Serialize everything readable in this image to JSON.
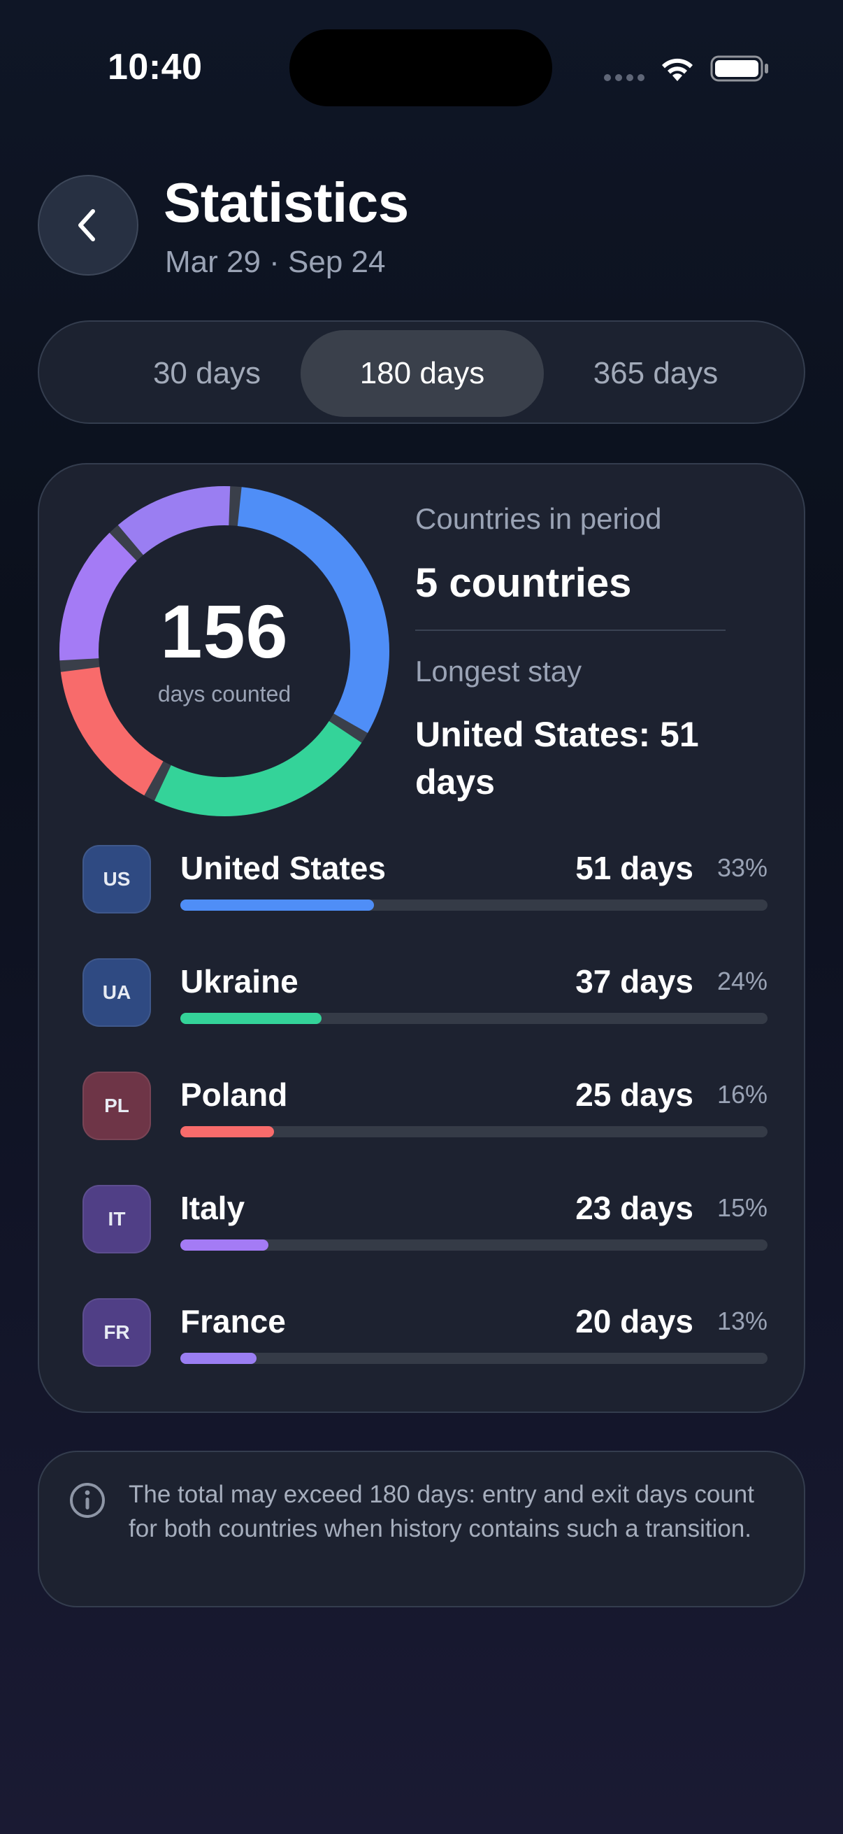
{
  "status_bar": {
    "time": "10:40"
  },
  "header": {
    "title": "Statistics",
    "subtitle": "Mar 29 · Sep 24"
  },
  "period_tabs": [
    {
      "label": "30 days",
      "selected": false
    },
    {
      "label": "180 days",
      "selected": true
    },
    {
      "label": "365 days",
      "selected": false
    }
  ],
  "summary": {
    "total_days": "156",
    "total_label": "days counted",
    "countries_label": "Countries in period",
    "countries_value": "5 countries",
    "longest_label": "Longest stay",
    "longest_value": "United States: 51 days"
  },
  "chart_data": {
    "type": "pie",
    "categories": [
      "United States",
      "Ukraine",
      "Poland",
      "Italy",
      "France"
    ],
    "values": [
      51,
      37,
      25,
      23,
      20
    ],
    "colors": [
      "#4f8ef7",
      "#34d399",
      "#f86b6b",
      "#a47bf5",
      "#9a7ef2"
    ]
  },
  "countries": [
    {
      "code": "US",
      "name": "United States",
      "days": "51 days",
      "pct": "33%",
      "share": 0.33,
      "color": "#4f8ef7",
      "badge_bg": "#2f4a82"
    },
    {
      "code": "UA",
      "name": "Ukraine",
      "days": "37 days",
      "pct": "24%",
      "share": 0.24,
      "color": "#34d399",
      "badge_bg": "#2f4a82"
    },
    {
      "code": "PL",
      "name": "Poland",
      "days": "25 days",
      "pct": "16%",
      "share": 0.16,
      "color": "#f86b6b",
      "badge_bg": "#6e3547"
    },
    {
      "code": "IT",
      "name": "Italy",
      "days": "23 days",
      "pct": "15%",
      "share": 0.15,
      "color": "#a47bf5",
      "badge_bg": "#503f86"
    },
    {
      "code": "FR",
      "name": "France",
      "days": "20 days",
      "pct": "13%",
      "share": 0.13,
      "color": "#9a7ef2",
      "badge_bg": "#503f86"
    }
  ],
  "info_note": "The total may exceed 180 days: entry and exit days count for both countries when history contains such a transition."
}
